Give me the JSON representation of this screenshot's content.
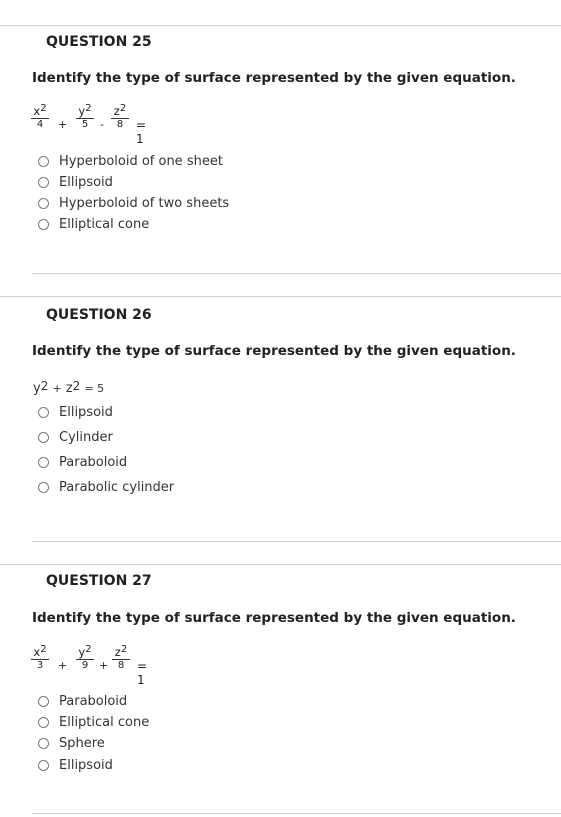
{
  "q25": {
    "title": "QUESTION 25",
    "prompt": "Identify the type of surface represented by the given equation.",
    "eq": {
      "t1n": "x2",
      "t1d": "4",
      "op1": "+",
      "t2n": "y2",
      "t2d": "5",
      "op2": "-",
      "t3n": "z2",
      "t3d": "8",
      "rhs": "= 1"
    },
    "options": [
      "Hyperboloid of one sheet",
      "Ellipsoid",
      "Hyperboloid of two sheets",
      "Elliptical cone"
    ]
  },
  "q26": {
    "title": "QUESTION 26",
    "prompt": "Identify the type of surface represented by the given equation.",
    "eq": {
      "a": "y",
      "a_exp": "2",
      "op": "+",
      "b": "z",
      "b_exp": "2",
      "rhs": "= 5"
    },
    "options": [
      "Ellipsoid",
      "Cylinder",
      "Paraboloid",
      "Parabolic cylinder"
    ]
  },
  "q27": {
    "title": "QUESTION 27",
    "prompt": "Identify the type of surface represented by the given equation.",
    "eq": {
      "t1n": "x2",
      "t1d": "3",
      "op1": "+",
      "t2n": "y2",
      "t2d": "9",
      "op2": "+",
      "t3n": "z2",
      "t3d": "8",
      "rhs": "= 1"
    },
    "options": [
      "Paraboloid",
      "Elliptical cone",
      "Sphere",
      "Ellipsoid"
    ]
  }
}
